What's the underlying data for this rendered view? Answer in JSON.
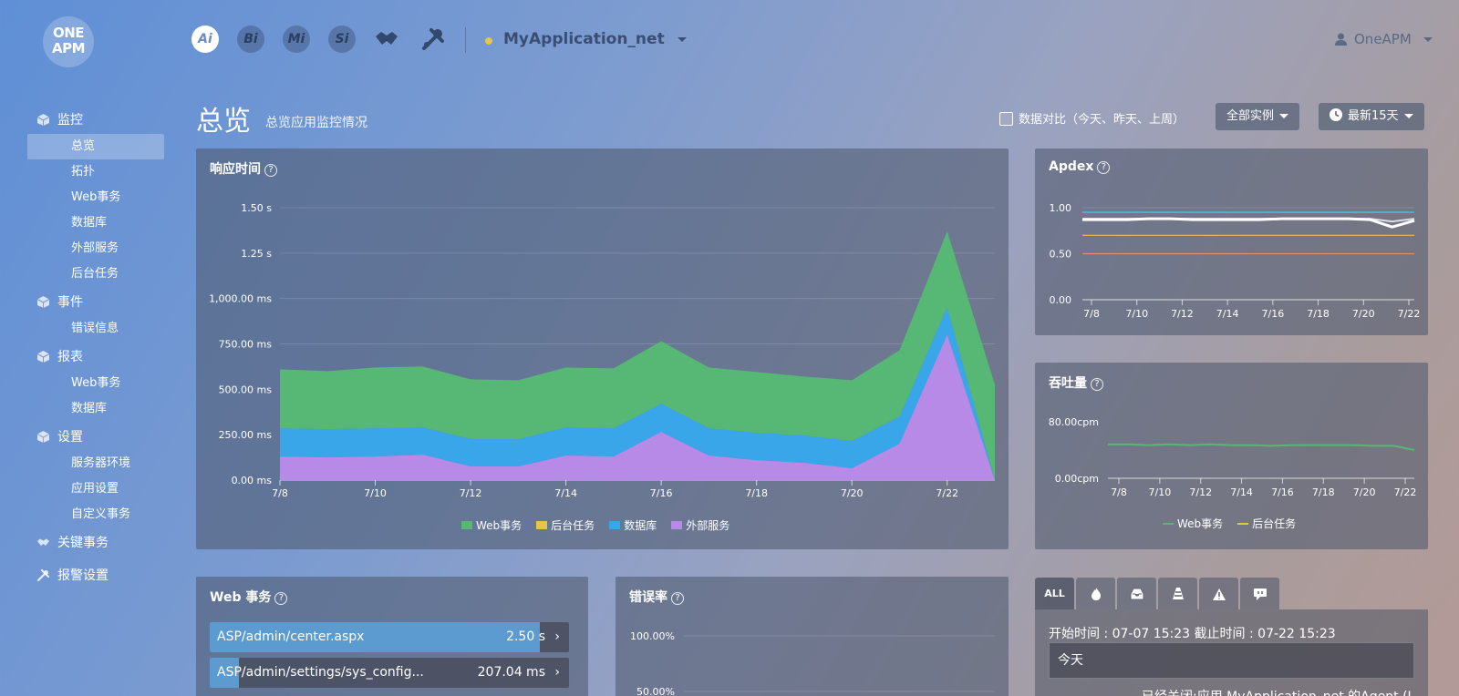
{
  "header": {
    "logo_text": "ONE APM",
    "products": [
      "Ai",
      "Bi",
      "Mi",
      "Si"
    ],
    "app_name": "MyApplication_net",
    "user_name": "OneAPM"
  },
  "sidebar": {
    "groups": [
      {
        "label": "监控",
        "items": [
          "总览",
          "拓扑",
          "Web事务",
          "数据库",
          "外部服务",
          "后台任务"
        ]
      },
      {
        "label": "事件",
        "items": [
          "错误信息"
        ]
      },
      {
        "label": "报表",
        "items": [
          "Web事务",
          "数据库"
        ]
      },
      {
        "label": "设置",
        "items": [
          "服务器环境",
          "应用设置",
          "自定义事务"
        ]
      },
      {
        "label": "关键事务",
        "items": []
      },
      {
        "label": "报警设置",
        "items": []
      }
    ],
    "active_item": "总览"
  },
  "page": {
    "title": "总览",
    "subtitle": "总览应用监控情况",
    "compare_label": "数据对比（今天、昨天、上周）",
    "instances_label": "全部实例",
    "range_label": "最新15天"
  },
  "panels": {
    "response_title": "响应时间",
    "apdex_title": "Apdex",
    "throughput_title": "吞吐量",
    "web_tx_title": "Web 事务",
    "error_title": "错误率"
  },
  "colors": {
    "web": "#56b874",
    "background_task": "#e8c34d",
    "database": "#3aa6ea",
    "external": "#b78ae8",
    "apdex_cyan": "#3ec6d8",
    "apdex_yellow": "#e8c34d",
    "apdex_red": "#e28a7a"
  },
  "chart_data": [
    {
      "type": "area",
      "title": "响应时间",
      "x": [
        "7/8",
        "7/9",
        "7/10",
        "7/11",
        "7/12",
        "7/13",
        "7/14",
        "7/15",
        "7/16",
        "7/17",
        "7/18",
        "7/19",
        "7/20",
        "7/21",
        "7/22",
        "7/23"
      ],
      "x_ticks": [
        "7/8",
        "7/10",
        "7/12",
        "7/14",
        "7/16",
        "7/18",
        "7/20",
        "7/22"
      ],
      "y_ticks": [
        "0.00 ms",
        "250.00 ms",
        "500.00 ms",
        "750.00 ms",
        "1,000.00 ms",
        "1.25 s",
        "1.50 s"
      ],
      "ylim": [
        0,
        1500
      ],
      "stacked": true,
      "series": [
        {
          "name": "外部服务",
          "values": [
            130,
            125,
            130,
            140,
            75,
            75,
            135,
            130,
            265,
            135,
            110,
            95,
            65,
            200,
            800,
            0
          ]
        },
        {
          "name": "数据库",
          "values": [
            155,
            155,
            155,
            150,
            150,
            150,
            155,
            155,
            155,
            150,
            150,
            150,
            150,
            150,
            150,
            0
          ]
        },
        {
          "name": "后台任务",
          "values": [
            0,
            0,
            0,
            0,
            0,
            0,
            0,
            0,
            0,
            0,
            0,
            0,
            0,
            0,
            0,
            0
          ]
        },
        {
          "name": "Web事务",
          "values": [
            325,
            320,
            335,
            335,
            330,
            325,
            330,
            330,
            345,
            335,
            335,
            325,
            335,
            365,
            420,
            525
          ]
        }
      ],
      "legend": [
        "Web事务",
        "后台任务",
        "数据库",
        "外部服务"
      ],
      "legend_position": "bottom"
    },
    {
      "type": "line",
      "title": "Apdex",
      "x_ticks": [
        "7/8",
        "7/10",
        "7/12",
        "7/14",
        "7/16",
        "7/18",
        "7/20",
        "7/22"
      ],
      "y_ticks": [
        "0.00",
        "0.50",
        "1.00"
      ],
      "ylim": [
        0,
        1.0
      ],
      "series": [
        {
          "values": [
            0.95,
            0.95,
            0.95,
            0.95,
            0.95,
            0.95,
            0.95,
            0.95,
            0.95,
            0.95,
            0.95,
            0.95,
            0.95,
            0.95,
            0.95,
            0.95
          ]
        },
        {
          "values": [
            0.88,
            0.88,
            0.88,
            0.88,
            0.88,
            0.88,
            0.88,
            0.88,
            0.88,
            0.88,
            0.88,
            0.88,
            0.88,
            0.88,
            0.85,
            0.88
          ]
        },
        {
          "values": [
            0.87,
            0.87,
            0.87,
            0.88,
            0.88,
            0.87,
            0.87,
            0.87,
            0.87,
            0.88,
            0.88,
            0.88,
            0.88,
            0.87,
            0.79,
            0.86
          ]
        },
        {
          "values": [
            0.7,
            0.7,
            0.7,
            0.7,
            0.7,
            0.7,
            0.7,
            0.7,
            0.7,
            0.7,
            0.7,
            0.7,
            0.7,
            0.7,
            0.7,
            0.7
          ]
        },
        {
          "values": [
            0.5,
            0.5,
            0.5,
            0.5,
            0.5,
            0.5,
            0.5,
            0.5,
            0.5,
            0.5,
            0.5,
            0.5,
            0.5,
            0.5,
            0.5,
            0.5
          ]
        }
      ]
    },
    {
      "type": "line",
      "title": "吞吐量",
      "x_ticks": [
        "7/8",
        "7/10",
        "7/12",
        "7/14",
        "7/16",
        "7/18",
        "7/20",
        "7/22"
      ],
      "y_ticks": [
        "0.00cpm",
        "80.00cpm"
      ],
      "ylim": [
        0,
        80
      ],
      "series": [
        {
          "name": "Web事务",
          "values": [
            48,
            48,
            47,
            48,
            47,
            48,
            47,
            47,
            46,
            47,
            47,
            47,
            47,
            46,
            46,
            40
          ]
        },
        {
          "name": "后台任务",
          "values": []
        }
      ],
      "legend": [
        "Web事务",
        "后台任务"
      ],
      "legend_position": "bottom"
    },
    {
      "type": "line",
      "title": "错误率",
      "y_ticks": [
        "100.00%",
        "50.00%"
      ],
      "ylim": [
        0,
        100
      ],
      "series": []
    }
  ],
  "web_transactions": [
    {
      "name": "ASP/admin/center.aspx",
      "value": "2.50 s",
      "fraction": 0.92
    },
    {
      "name": "ASP/admin/settings/sys_config...",
      "value": "207.04 ms",
      "fraction": 0.08
    }
  ],
  "events": {
    "tabs": [
      "ALL",
      "fire-icon",
      "inbox-icon",
      "cone-icon",
      "warning-icon",
      "chat-icon"
    ],
    "time_range": "开始时间 : 07-07 15:23 截止时间 : 07-22 15:23",
    "day_label": "今天",
    "message": "已经关闭:应用 MyApplication_net 的Agent (I..."
  }
}
